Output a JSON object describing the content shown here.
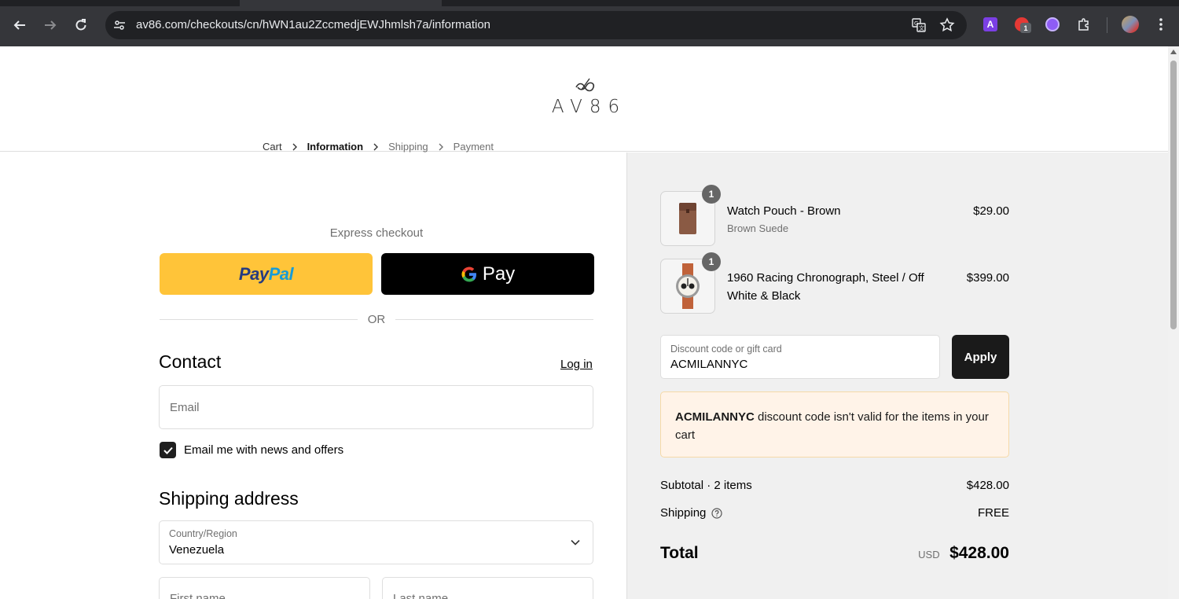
{
  "browser": {
    "url": "av86.com/checkouts/cn/hWN1au2ZccmedjEWJhmlsh7a/information",
    "extension_badge": "1"
  },
  "header": {
    "logo_text": "AV86"
  },
  "breadcrumb": {
    "items": [
      {
        "label": "Cart"
      },
      {
        "label": "Information"
      },
      {
        "label": "Shipping"
      },
      {
        "label": "Payment"
      }
    ]
  },
  "express": {
    "label": "Express checkout",
    "paypal_part1": "Pay",
    "paypal_part2": "Pal",
    "gpay_label": "Pay",
    "or_label": "OR"
  },
  "contact": {
    "title": "Contact",
    "login_label": "Log in",
    "email_placeholder": "Email",
    "newsletter_label": "Email me with news and offers",
    "newsletter_checked": true
  },
  "shipping": {
    "title": "Shipping address",
    "country_label": "Country/Region",
    "country_value": "Venezuela",
    "first_name_placeholder": "First name",
    "last_name_placeholder": "Last name"
  },
  "cart": {
    "items": [
      {
        "name": "Watch Pouch - Brown",
        "variant": "Brown Suede",
        "price": "$29.00",
        "quantity": "1"
      },
      {
        "name": "1960 Racing Chronograph, Steel / Off White & Black",
        "variant": "",
        "price": "$399.00",
        "quantity": "1"
      }
    ],
    "discount_label": "Discount code or gift card",
    "discount_value": "ACMILANNYC",
    "apply_label": "Apply",
    "error_code": "ACMILANNYC",
    "error_message": " discount code isn't valid for the items in your cart",
    "subtotal_label": "Subtotal · 2 items",
    "subtotal_value": "$428.00",
    "shipping_label": "Shipping",
    "shipping_value": "FREE",
    "total_label": "Total",
    "total_currency": "USD",
    "total_value": "$428.00"
  },
  "colors": {
    "paypal_yellow": "#ffc439",
    "gpay_black": "#000000",
    "apply_dark": "#1a1a1a",
    "error_bg": "#fff3e8",
    "summary_bg": "#f0f0f0"
  }
}
